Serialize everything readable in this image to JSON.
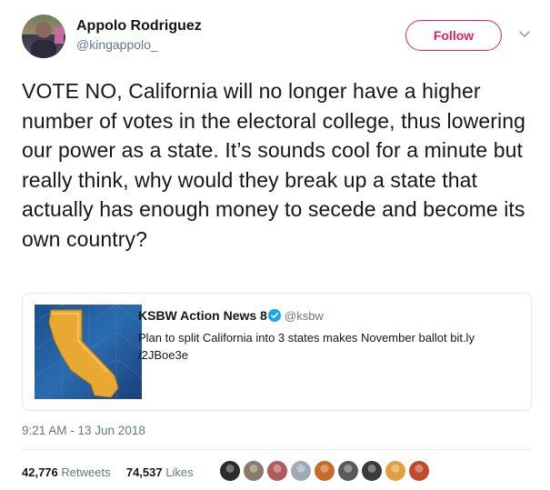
{
  "author": {
    "name": "Appolo Rodriguez",
    "handle": "@kingappolo_"
  },
  "actions": {
    "follow_label": "Follow"
  },
  "tweet": {
    "text": "VOTE NO, California will no longer have a higher number of votes in the electoral college, thus lowering our power as a state. It’s sounds cool for a minute but really think, why would they break up a state that actually has enough money to secede and become its own country?",
    "timestamp": "9:21 AM - 13 Jun 2018"
  },
  "quoted": {
    "name": "KSBW Action News 8",
    "handle": "@ksbw",
    "text_line1": "Plan to split California into 3 states makes November ballot bit.ly",
    "text_line2": "/2JBoe3e"
  },
  "stats": {
    "retweets_count": "42,776",
    "retweets_label": "Retweets",
    "likes_count": "74,537",
    "likes_label": "Likes"
  },
  "colors": {
    "accent": "#e0245e",
    "muted": "#657786",
    "verified": "#1da1f2"
  },
  "icons": {
    "caret": "chevron-down-icon",
    "verified": "verified-badge-icon"
  },
  "likers": [
    {
      "color": "#2b2b2b"
    },
    {
      "color": "#8a7a6a"
    },
    {
      "color": "#b05a5a"
    },
    {
      "color": "#a0aab4"
    },
    {
      "color": "#c86a2a"
    },
    {
      "color": "#5a5a5a"
    },
    {
      "color": "#3a3a3a"
    },
    {
      "color": "#e0a040"
    },
    {
      "color": "#c04a2a"
    }
  ]
}
